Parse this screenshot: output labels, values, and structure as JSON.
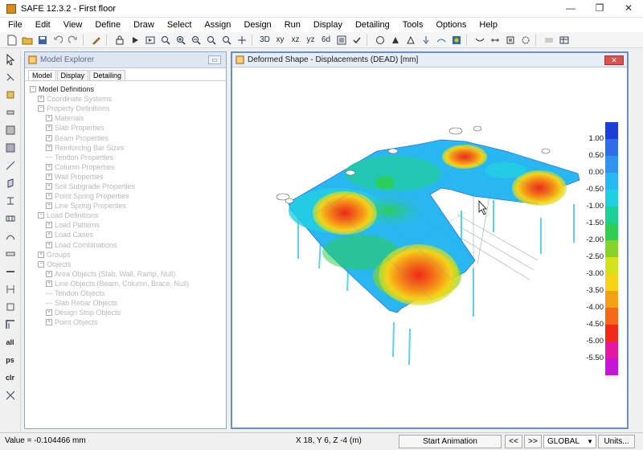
{
  "window": {
    "title": "SAFE 12.3.2 - First floor",
    "minimize": "—",
    "restore": "❐",
    "close": "✕"
  },
  "menu": [
    "File",
    "Edit",
    "View",
    "Define",
    "Draw",
    "Select",
    "Assign",
    "Design",
    "Run",
    "Display",
    "Detailing",
    "Tools",
    "Options",
    "Help"
  ],
  "toolbar_text": {
    "view3d": "3D",
    "xy": "xy",
    "xz": "xz",
    "yz": "yz",
    "sixdb": "6d"
  },
  "left_tools_text": {
    "all": "all",
    "ps": "ps",
    "clr": "clr"
  },
  "explorer": {
    "title": "Model Explorer",
    "close_label": "▭",
    "tabs": [
      "Model",
      "Display",
      "Detailing"
    ],
    "tree": [
      {
        "label": "Model Definitions",
        "level": 0,
        "exp": "−",
        "root": true
      },
      {
        "label": "Coordinate Systems",
        "level": 1,
        "exp": "+"
      },
      {
        "label": "Property Definitions",
        "level": 1,
        "exp": "−"
      },
      {
        "label": "Materials",
        "level": 2,
        "exp": "+"
      },
      {
        "label": "Slab Properties",
        "level": 2,
        "exp": "+"
      },
      {
        "label": "Beam Properties",
        "level": 2,
        "exp": "+"
      },
      {
        "label": "Reinforcing Bar Sizes",
        "level": 2,
        "exp": "+"
      },
      {
        "label": "Tendon Properties",
        "level": 2,
        "exp": ""
      },
      {
        "label": "Column Properties",
        "level": 2,
        "exp": "+"
      },
      {
        "label": "Wall Properties",
        "level": 2,
        "exp": "+"
      },
      {
        "label": "Soil Subgrade Properties",
        "level": 2,
        "exp": "+"
      },
      {
        "label": "Point Spring Properties",
        "level": 2,
        "exp": "+"
      },
      {
        "label": "Line Spring Properties",
        "level": 2,
        "exp": "+"
      },
      {
        "label": "Load Definitions",
        "level": 1,
        "exp": "−"
      },
      {
        "label": "Load Patterns",
        "level": 2,
        "exp": "+"
      },
      {
        "label": "Load Cases",
        "level": 2,
        "exp": "+"
      },
      {
        "label": "Load Combinations",
        "level": 2,
        "exp": "+"
      },
      {
        "label": "Groups",
        "level": 1,
        "exp": "+"
      },
      {
        "label": "Objects",
        "level": 1,
        "exp": "−"
      },
      {
        "label": "Area Objects (Slab, Wall, Ramp, Null)",
        "level": 2,
        "exp": "+"
      },
      {
        "label": "Line Objects (Beam, Column, Brace, Null)",
        "level": 2,
        "exp": "+"
      },
      {
        "label": "Tendon Objects",
        "level": 2,
        "exp": ""
      },
      {
        "label": "Slab Rebar Objects",
        "level": 2,
        "exp": ""
      },
      {
        "label": "Design Strip Objects",
        "level": 2,
        "exp": "+"
      },
      {
        "label": "Point Objects",
        "level": 2,
        "exp": "+"
      }
    ]
  },
  "view": {
    "title": "Deformed Shape - Displacements (DEAD)  [mm]",
    "close_label": "✕",
    "legend": {
      "labels": [
        "1.00",
        "0.50",
        "0.00",
        "-0.50",
        "-1.00",
        "-1.50",
        "-2.00",
        "-2.50",
        "-3.00",
        "-3.50",
        "-4.00",
        "-4.50",
        "-5.00",
        "-5.50"
      ],
      "colors": [
        "#1c3fd6",
        "#2f6ee8",
        "#2f94f0",
        "#29b7f2",
        "#22cfe0",
        "#1fcf96",
        "#2ecf52",
        "#86d32a",
        "#d2e21e",
        "#f5d21b",
        "#f5a019",
        "#f26a17",
        "#ee2a18",
        "#e2189e",
        "#c516d8"
      ]
    }
  },
  "statusbar": {
    "value": "Value = -0.104466 mm",
    "coords": "X 18,  Y 6,  Z -4  (m)",
    "animation": "Start Animation",
    "prev": "<<",
    "next": ">>",
    "coord_system": "GLOBAL",
    "units": "Units..."
  }
}
